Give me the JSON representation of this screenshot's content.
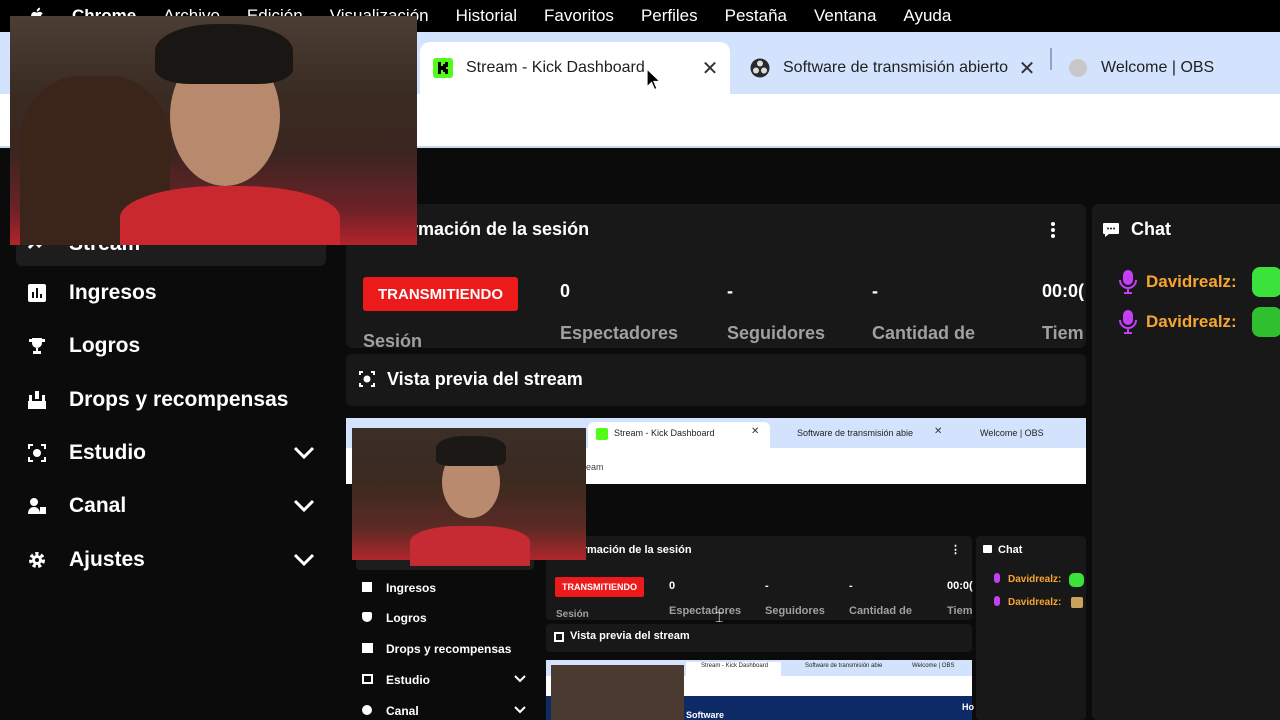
{
  "menubar": {
    "app": "Chrome",
    "items": [
      "Archivo",
      "Edición",
      "Visualización",
      "Historial",
      "Favoritos",
      "Perfiles",
      "Pestaña",
      "Ventana",
      "Ayuda"
    ]
  },
  "tabs": [
    {
      "title": "Stream - Kick Dashboard",
      "icon": "kick-logo-icon",
      "active": true
    },
    {
      "title": "Software de transmisión abierto",
      "icon": "obs-logo-icon",
      "active": false
    },
    {
      "title": "Welcome | OBS",
      "icon": "globe-icon",
      "active": false
    }
  ],
  "address": {
    "url_fragment": "eam"
  },
  "sidebar": {
    "items": [
      {
        "label": "Stream",
        "icon": "stream-icon"
      },
      {
        "label": "Ingresos",
        "icon": "bar-chart-icon"
      },
      {
        "label": "Logros",
        "icon": "trophy-icon"
      },
      {
        "label": "Drops y recompensas",
        "icon": "drops-icon"
      },
      {
        "label": "Estudio",
        "icon": "studio-icon"
      },
      {
        "label": "Canal",
        "icon": "channel-icon"
      },
      {
        "label": "Ajustes",
        "icon": "gear-icon"
      }
    ]
  },
  "session": {
    "title": "ormación de la sesión",
    "status": "TRANSMITIENDO",
    "status_label": "Sesión",
    "stats": [
      {
        "value": "0",
        "label": "Espectadores"
      },
      {
        "value": "-",
        "label": "Seguidores"
      },
      {
        "value": "-",
        "label": "Cantidad de"
      },
      {
        "value": "00:0(",
        "label": "Tiem"
      }
    ]
  },
  "preview": {
    "title": "Vista previa del stream"
  },
  "chat": {
    "title": "Chat",
    "messages": [
      {
        "user": "Davidrealz:",
        "emote": "green-blob-emote"
      },
      {
        "user": "Davidrealz:",
        "emote": "green-face-emote"
      }
    ]
  },
  "nested": {
    "tabs": [
      "Stream - Kick Dashboard",
      "Software de transmisión abie",
      "Welcome | OBS"
    ],
    "url": "eam",
    "session_title": "ormación de la sesión",
    "status": "TRANSMITIENDO",
    "status_label": "Sesión",
    "stats": [
      "0",
      "-",
      "-",
      "00:0("
    ],
    "stat_labels": [
      "Espectadores",
      "Seguidores",
      "Cantidad de",
      "Tiem"
    ],
    "sidebar": [
      "Ingresos",
      "Logros",
      "Drops y recompensas",
      "Estudio",
      "Canal"
    ],
    "preview_title": "Vista previa del stream",
    "chat_title": "Chat",
    "chat_users": [
      "Davidrealz:",
      "Davidrealz:"
    ],
    "deep_tabs": [
      "Stream - Kick Dashboard",
      "Software de transmisión abie",
      "Welcome | OBS"
    ],
    "deep_text": "Software",
    "deep_corner": "Ho"
  },
  "colors": {
    "accent_green": "#53fc18",
    "live_red": "#ec1a1a",
    "chat_user": "#f7a531",
    "tab_strip": "#d3e3fd"
  }
}
